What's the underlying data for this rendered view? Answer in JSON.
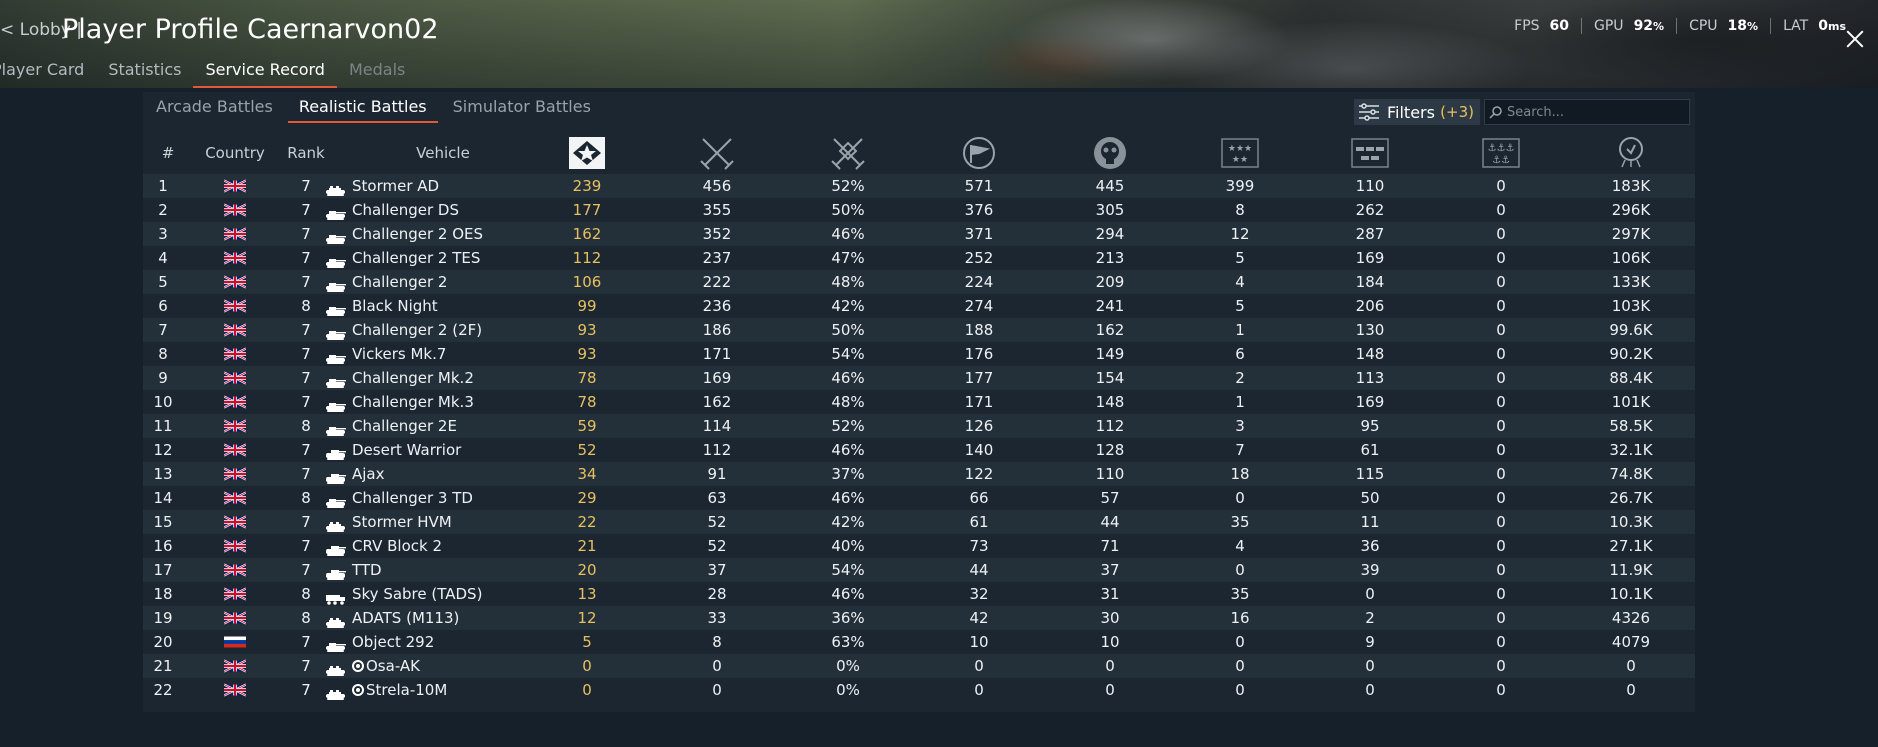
{
  "header": {
    "back_label": "< Lobby |",
    "title": "Player Profile Caernarvon02",
    "tabs": [
      {
        "label": "Player Card",
        "state": "normal"
      },
      {
        "label": "Statistics",
        "state": "normal"
      },
      {
        "label": "Service Record",
        "state": "active"
      },
      {
        "label": "Medals",
        "state": "disabled"
      }
    ],
    "perf": [
      {
        "label": "FPS",
        "value": "60",
        "unit": ""
      },
      {
        "label": "GPU",
        "value": "92",
        "unit": "%"
      },
      {
        "label": "CPU",
        "value": "18",
        "unit": "%"
      },
      {
        "label": "LAT",
        "value": "0",
        "unit": "ms"
      }
    ]
  },
  "mode_tabs": [
    {
      "label": "Arcade Battles",
      "active": false
    },
    {
      "label": "Realistic Battles",
      "active": true
    },
    {
      "label": "Simulator Battles",
      "active": false
    }
  ],
  "filters": {
    "label": "Filters",
    "count": "(+3)"
  },
  "search": {
    "placeholder": "Search..."
  },
  "columns": {
    "num": "#",
    "country": "Country",
    "rank": "Rank",
    "vehicle": "Vehicle",
    "stat_icons": [
      "battles-icon",
      "victories-icon",
      "win-rate-icon",
      "respawns-icon",
      "deaths-icon",
      "air-kills-icon",
      "ground-kills-icon",
      "naval-kills-icon",
      "activity-icon"
    ]
  },
  "colors": {
    "accent": "#e05a3a",
    "gold": "#e8c060",
    "background": "#16202a"
  },
  "rows": [
    {
      "n": "1",
      "country": "uk",
      "rank": "7",
      "icon": "tank-spaa-icon",
      "mark": false,
      "vehicle": "Stormer AD",
      "battles": "239",
      "wins": "456",
      "wr": "52%",
      "resp": "571",
      "deaths": "445",
      "air": "399",
      "ground": "110",
      "naval": "0",
      "act": "183K"
    },
    {
      "n": "2",
      "country": "uk",
      "rank": "7",
      "icon": "tank-medium-icon",
      "mark": false,
      "vehicle": "Challenger DS",
      "battles": "177",
      "wins": "355",
      "wr": "50%",
      "resp": "376",
      "deaths": "305",
      "air": "8",
      "ground": "262",
      "naval": "0",
      "act": "296K"
    },
    {
      "n": "3",
      "country": "uk",
      "rank": "7",
      "icon": "tank-medium-icon",
      "mark": false,
      "vehicle": "Challenger 2 OES",
      "battles": "162",
      "wins": "352",
      "wr": "46%",
      "resp": "371",
      "deaths": "294",
      "air": "12",
      "ground": "287",
      "naval": "0",
      "act": "297K"
    },
    {
      "n": "4",
      "country": "uk",
      "rank": "7",
      "icon": "tank-medium-icon",
      "mark": false,
      "vehicle": "Challenger 2 TES",
      "battles": "112",
      "wins": "237",
      "wr": "47%",
      "resp": "252",
      "deaths": "213",
      "air": "5",
      "ground": "169",
      "naval": "0",
      "act": "106K"
    },
    {
      "n": "5",
      "country": "uk",
      "rank": "7",
      "icon": "tank-medium-icon",
      "mark": false,
      "vehicle": "Challenger 2",
      "battles": "106",
      "wins": "222",
      "wr": "48%",
      "resp": "224",
      "deaths": "209",
      "air": "4",
      "ground": "184",
      "naval": "0",
      "act": "133K"
    },
    {
      "n": "6",
      "country": "uk",
      "rank": "8",
      "icon": "tank-medium-icon",
      "mark": false,
      "vehicle": "Black Night",
      "battles": "99",
      "wins": "236",
      "wr": "42%",
      "resp": "274",
      "deaths": "241",
      "air": "5",
      "ground": "206",
      "naval": "0",
      "act": "103K"
    },
    {
      "n": "7",
      "country": "uk",
      "rank": "7",
      "icon": "tank-medium-icon",
      "mark": false,
      "vehicle": "Challenger 2 (2F)",
      "battles": "93",
      "wins": "186",
      "wr": "50%",
      "resp": "188",
      "deaths": "162",
      "air": "1",
      "ground": "130",
      "naval": "0",
      "act": "99.6K"
    },
    {
      "n": "8",
      "country": "uk",
      "rank": "7",
      "icon": "tank-medium-icon",
      "mark": false,
      "vehicle": "Vickers Mk.7",
      "battles": "93",
      "wins": "171",
      "wr": "54%",
      "resp": "176",
      "deaths": "149",
      "air": "6",
      "ground": "148",
      "naval": "0",
      "act": "90.2K"
    },
    {
      "n": "9",
      "country": "uk",
      "rank": "7",
      "icon": "tank-medium-icon",
      "mark": false,
      "vehicle": "Challenger Mk.2",
      "battles": "78",
      "wins": "169",
      "wr": "46%",
      "resp": "177",
      "deaths": "154",
      "air": "2",
      "ground": "113",
      "naval": "0",
      "act": "88.4K"
    },
    {
      "n": "10",
      "country": "uk",
      "rank": "7",
      "icon": "tank-medium-icon",
      "mark": false,
      "vehicle": "Challenger Mk.3",
      "battles": "78",
      "wins": "162",
      "wr": "48%",
      "resp": "171",
      "deaths": "148",
      "air": "1",
      "ground": "169",
      "naval": "0",
      "act": "101K"
    },
    {
      "n": "11",
      "country": "uk",
      "rank": "8",
      "icon": "tank-medium-icon",
      "mark": false,
      "vehicle": "Challenger 2E",
      "battles": "59",
      "wins": "114",
      "wr": "52%",
      "resp": "126",
      "deaths": "112",
      "air": "3",
      "ground": "95",
      "naval": "0",
      "act": "58.5K"
    },
    {
      "n": "12",
      "country": "uk",
      "rank": "7",
      "icon": "tank-light-icon",
      "mark": false,
      "vehicle": "Desert Warrior",
      "battles": "52",
      "wins": "112",
      "wr": "46%",
      "resp": "140",
      "deaths": "128",
      "air": "7",
      "ground": "61",
      "naval": "0",
      "act": "32.1K"
    },
    {
      "n": "13",
      "country": "uk",
      "rank": "7",
      "icon": "tank-light-icon",
      "mark": false,
      "vehicle": "Ajax",
      "battles": "34",
      "wins": "91",
      "wr": "37%",
      "resp": "122",
      "deaths": "110",
      "air": "18",
      "ground": "115",
      "naval": "0",
      "act": "74.8K"
    },
    {
      "n": "14",
      "country": "uk",
      "rank": "8",
      "icon": "tank-medium-icon",
      "mark": false,
      "vehicle": "Challenger 3 TD",
      "battles": "29",
      "wins": "63",
      "wr": "46%",
      "resp": "66",
      "deaths": "57",
      "air": "0",
      "ground": "50",
      "naval": "0",
      "act": "26.7K"
    },
    {
      "n": "15",
      "country": "uk",
      "rank": "7",
      "icon": "tank-spaa-icon",
      "mark": false,
      "vehicle": "Stormer HVM",
      "battles": "22",
      "wins": "52",
      "wr": "42%",
      "resp": "61",
      "deaths": "44",
      "air": "35",
      "ground": "11",
      "naval": "0",
      "act": "10.3K"
    },
    {
      "n": "16",
      "country": "uk",
      "rank": "7",
      "icon": "tank-light-icon",
      "mark": false,
      "vehicle": "CRV Block 2",
      "battles": "21",
      "wins": "52",
      "wr": "40%",
      "resp": "73",
      "deaths": "71",
      "air": "4",
      "ground": "36",
      "naval": "0",
      "act": "27.1K"
    },
    {
      "n": "17",
      "country": "uk",
      "rank": "7",
      "icon": "tank-light-icon",
      "mark": false,
      "vehicle": "TTD",
      "battles": "20",
      "wins": "37",
      "wr": "54%",
      "resp": "44",
      "deaths": "37",
      "air": "0",
      "ground": "39",
      "naval": "0",
      "act": "11.9K"
    },
    {
      "n": "18",
      "country": "uk",
      "rank": "8",
      "icon": "truck-spaa-icon",
      "mark": false,
      "vehicle": "Sky Sabre (TADS)",
      "battles": "13",
      "wins": "28",
      "wr": "46%",
      "resp": "32",
      "deaths": "31",
      "air": "35",
      "ground": "0",
      "naval": "0",
      "act": "10.1K"
    },
    {
      "n": "19",
      "country": "uk",
      "rank": "8",
      "icon": "tank-spaa-icon",
      "mark": false,
      "vehicle": "ADATS (M113)",
      "battles": "12",
      "wins": "33",
      "wr": "36%",
      "resp": "42",
      "deaths": "30",
      "air": "16",
      "ground": "2",
      "naval": "0",
      "act": "4326"
    },
    {
      "n": "20",
      "country": "ru",
      "rank": "7",
      "icon": "tank-medium-icon",
      "mark": false,
      "vehicle": "Object 292",
      "battles": "5",
      "wins": "8",
      "wr": "63%",
      "resp": "10",
      "deaths": "10",
      "air": "0",
      "ground": "9",
      "naval": "0",
      "act": "4079"
    },
    {
      "n": "21",
      "country": "uk",
      "rank": "7",
      "icon": "tank-spaa-icon",
      "mark": true,
      "vehicle": "Osa-AK",
      "battles": "0",
      "wins": "0",
      "wr": "0%",
      "resp": "0",
      "deaths": "0",
      "air": "0",
      "ground": "0",
      "naval": "0",
      "act": "0"
    },
    {
      "n": "22",
      "country": "uk",
      "rank": "7",
      "icon": "tank-spaa-icon",
      "mark": true,
      "vehicle": "Strela-10M",
      "battles": "0",
      "wins": "0",
      "wr": "0%",
      "resp": "0",
      "deaths": "0",
      "air": "0",
      "ground": "0",
      "naval": "0",
      "act": "0"
    }
  ]
}
